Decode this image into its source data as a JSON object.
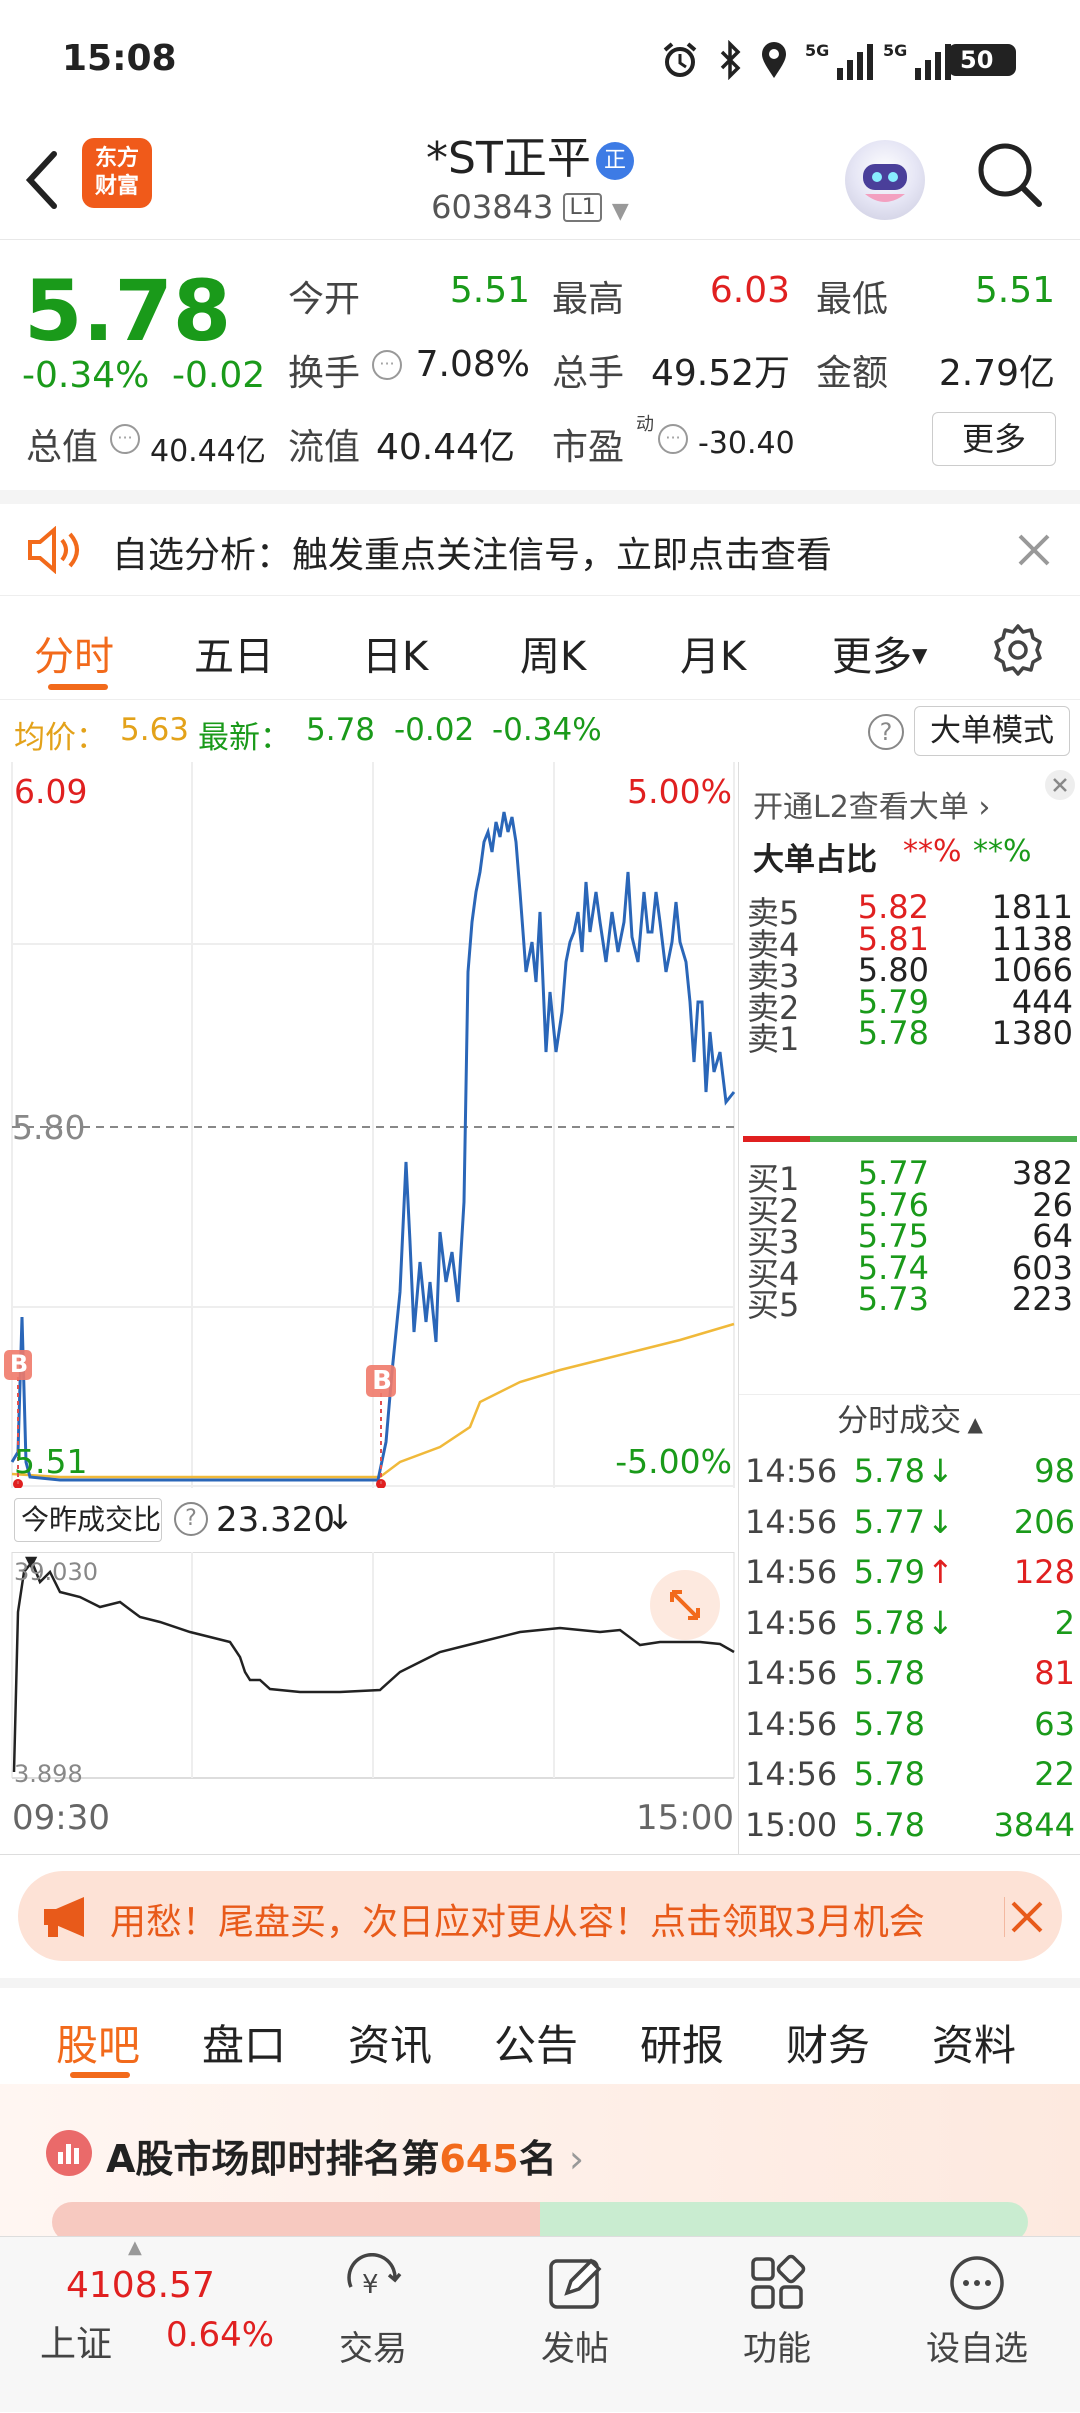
{
  "status_bar": {
    "time": "15:08",
    "battery": "50"
  },
  "header": {
    "logo_line1": "东方",
    "logo_line2": "财富",
    "title": "*ST正平",
    "title_badge": "正",
    "code": "603843",
    "level": "L1"
  },
  "quote": {
    "price": "5.78",
    "change_pct": "-0.34%",
    "change": "-0.02",
    "open_label": "今开",
    "open": "5.51",
    "high_label": "最高",
    "high": "6.03",
    "low_label": "最低",
    "low": "5.51",
    "turnover_label": "换手",
    "turnover": "7.08%",
    "volume_label": "总手",
    "volume": "49.52万",
    "amount_label": "金额",
    "amount": "2.79亿",
    "mktcap_label": "总值",
    "mktcap": "40.44亿",
    "float_label": "流值",
    "float": "40.44亿",
    "pe_label": "市盈",
    "pe_sup": "动",
    "pe": "-30.40",
    "more": "更多"
  },
  "notice": {
    "text": "自选分析：触发重点关注信号，立即点击查看"
  },
  "chart_tabs": [
    "分时",
    "五日",
    "日K",
    "周K",
    "月K",
    "更多"
  ],
  "info_line": {
    "avg_label": "均价：",
    "avg": "5.63",
    "latest_label": "最新：",
    "latest": "5.78",
    "change": "-0.02",
    "pct": "-0.34%",
    "mode_btn": "大单模式"
  },
  "chart_labels": {
    "top_price": "6.09",
    "top_pct": "5.00%",
    "mid_price": "5.80",
    "bottom_price": "5.51",
    "bottom_pct": "-5.00%",
    "buy_marker": "B"
  },
  "volume_panel": {
    "selector": "今昨成交比",
    "value": "23.320",
    "top": "39.030",
    "bottom": "3.898",
    "time_start": "09:30",
    "time_end": "15:00"
  },
  "order_book": {
    "l2_promo": "开通L2查看大单",
    "big_ratio_label": "大单占比",
    "big_ratio_sell": "**%",
    "big_ratio_buy": "**%",
    "asks": [
      {
        "label": "卖5",
        "price": "5.82",
        "vol": "1811",
        "color": "#e02020"
      },
      {
        "label": "卖4",
        "price": "5.81",
        "vol": "1138",
        "color": "#e02020"
      },
      {
        "label": "卖3",
        "price": "5.80",
        "vol": "1066",
        "color": "#222222"
      },
      {
        "label": "卖2",
        "price": "5.79",
        "vol": "444",
        "color": "#1a9a1a"
      },
      {
        "label": "卖1",
        "price": "5.78",
        "vol": "1380",
        "color": "#1a9a1a"
      }
    ],
    "bids": [
      {
        "label": "买1",
        "price": "5.77",
        "vol": "382",
        "color": "#1a9a1a"
      },
      {
        "label": "买2",
        "price": "5.76",
        "vol": "26",
        "color": "#1a9a1a"
      },
      {
        "label": "买3",
        "price": "5.75",
        "vol": "64",
        "color": "#1a9a1a"
      },
      {
        "label": "买4",
        "price": "5.74",
        "vol": "603",
        "color": "#1a9a1a"
      },
      {
        "label": "买5",
        "price": "5.73",
        "vol": "223",
        "color": "#1a9a1a"
      }
    ],
    "ticks_title": "分时成交",
    "ticks": [
      {
        "time": "14:56",
        "price": "5.78",
        "arrow": "↓",
        "vol": "98",
        "vol_color": "#1a9a1a"
      },
      {
        "time": "14:56",
        "price": "5.77",
        "arrow": "↓",
        "vol": "206",
        "vol_color": "#1a9a1a"
      },
      {
        "time": "14:56",
        "price": "5.79",
        "arrow": "↑",
        "vol": "128",
        "vol_color": "#e02020"
      },
      {
        "time": "14:56",
        "price": "5.78",
        "arrow": "↓",
        "vol": "2",
        "vol_color": "#1a9a1a"
      },
      {
        "time": "14:56",
        "price": "5.78",
        "arrow": "",
        "vol": "81",
        "vol_color": "#e02020"
      },
      {
        "time": "14:56",
        "price": "5.78",
        "arrow": "",
        "vol": "63",
        "vol_color": "#1a9a1a"
      },
      {
        "time": "14:56",
        "price": "5.78",
        "arrow": "",
        "vol": "22",
        "vol_color": "#1a9a1a"
      },
      {
        "time": "15:00",
        "price": "5.78",
        "arrow": "",
        "vol": "3844",
        "vol_color": "#1a9a1a"
      }
    ]
  },
  "promo": {
    "text": "用愁！尾盘买，次日应对更从容！点击领取3月机会"
  },
  "bottom_tabs": [
    "股吧",
    "盘口",
    "资讯",
    "公告",
    "研报",
    "财务",
    "资料"
  ],
  "ranking": {
    "prefix": "A股市场即时排名第",
    "rank": "645",
    "suffix": "名"
  },
  "nav": {
    "index_value": "4108.57",
    "index_name": "上证",
    "index_pct": "0.64%",
    "items": [
      "交易",
      "发帖",
      "功能",
      "设自选"
    ]
  },
  "colors": {
    "up": "#e02020",
    "down": "#1a9a1a",
    "accent": "#f26a1b",
    "price_line": "#2a66b8",
    "avg_line": "#f0b93a"
  }
}
